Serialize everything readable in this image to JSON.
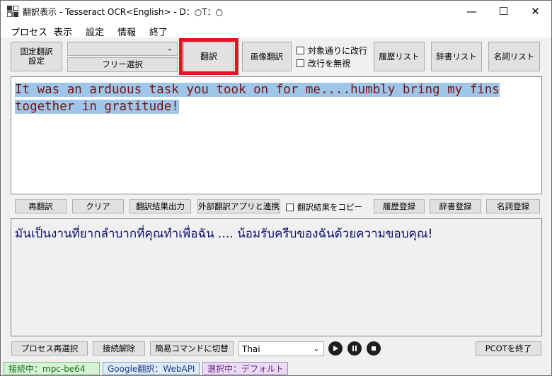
{
  "window": {
    "title": "翻訳表示 - Tesseract OCR<English> - D：○T：○",
    "controls": {
      "minimize": "—",
      "maximize": "☐",
      "close": "✕"
    }
  },
  "menu": [
    "プロセス",
    "表示",
    "設定",
    "情報",
    "終了"
  ],
  "toolbar": {
    "fixed_translation": [
      "固定翻訳",
      "設定"
    ],
    "free_select": "フリー選択",
    "translate": "翻訳",
    "image_translate": "画像翻訳",
    "check_linebreak": "対象通りに改行",
    "check_ignore_linebreak": "改行を無視",
    "history_list": "履歴リスト",
    "dictionary_list": "辞書リスト",
    "noun_list": "名詞リスト"
  },
  "source": {
    "text": "It was an arduous task you took on for me....humbly bring my fins together in gratitude!"
  },
  "mid_toolbar": {
    "retranslate": "再翻訳",
    "clear": "クリア",
    "output_result": "翻訳結果出力",
    "external_app": "外部翻訳アプリと連携",
    "copy_result": "翻訳結果をコピー",
    "register_history": "履歴登録",
    "register_dictionary": "辞書登録",
    "register_noun": "名詞登録"
  },
  "result": {
    "text": "มันเป็นงานที่ยากลำบากที่คุณทำเพื่อฉัน .... น้อมรับครีบของฉันด้วยความขอบคุณ!"
  },
  "bottom_toolbar": {
    "reselect_process": "プロセス再選択",
    "disconnect": "接続解除",
    "simple_command": "簡易コマンドに切替",
    "language": "Thai",
    "exit": "PCOTを終了",
    "icons": [
      "play-icon",
      "pause-icon",
      "stop-icon"
    ]
  },
  "statusbar": {
    "connection": "接続中：mpc-be64",
    "engine": "Google翻訳：WebAPI",
    "selection": "選択中：デフォルト"
  },
  "colors": {
    "highlight_border": "#e81123",
    "source_text": "#7b1212",
    "selection_bg": "#9ec6e8",
    "result_text": "#0b0b6e",
    "status_connection_bg": "#d6f3d6",
    "status_engine_bg": "#dfeaf7",
    "status_selection_bg": "#ebdcf3"
  }
}
